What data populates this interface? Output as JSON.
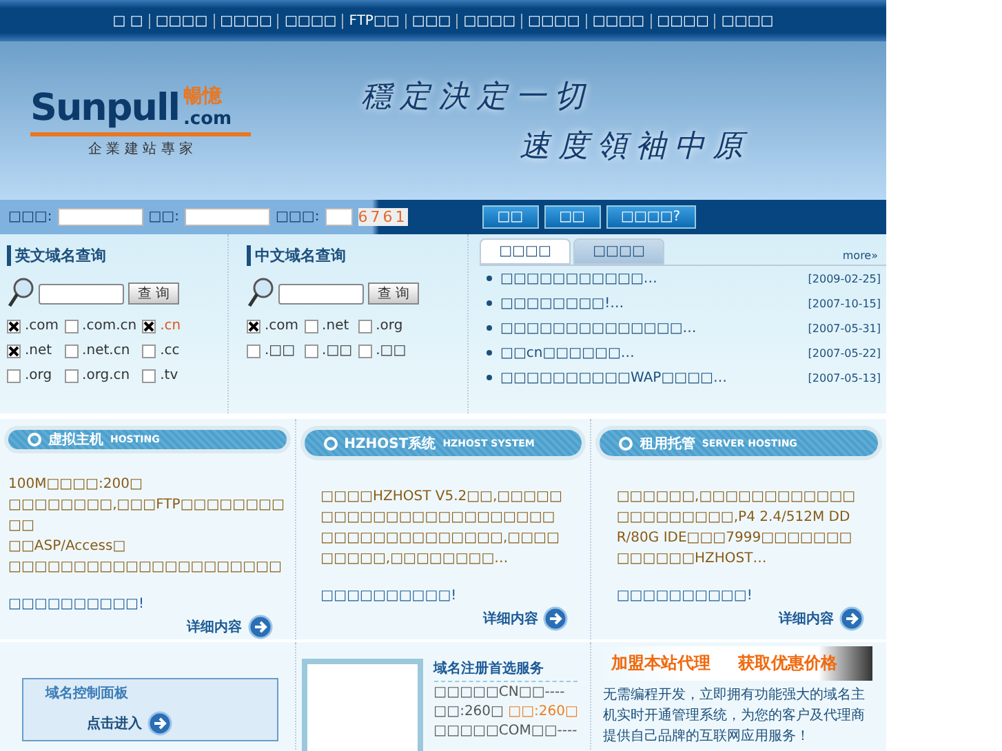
{
  "nav": [
    "□ □",
    "□□□□",
    "□□□□",
    "□□□□",
    "FTP□□",
    "□□□",
    "□□□□",
    "□□□□",
    "□□□□",
    "□□□□",
    "□□□□"
  ],
  "header": {
    "logo": "Sunpull",
    "logo_cn": "暢憶",
    "logo_com": ".com",
    "tagline": "企 業 建 站 專 家",
    "slogan": [
      "穩定決定一切",
      "速度領袖中原"
    ]
  },
  "login": {
    "fields": [
      {
        "label": "□□□:",
        "wide": true
      },
      {
        "label": "□□:",
        "wide": true
      },
      {
        "label": "□□□:",
        "wide": false
      }
    ],
    "captcha": "6761",
    "buttons": [
      "□□",
      "□□",
      "□□□□?"
    ]
  },
  "domain_search": [
    {
      "title": "英文域名查询",
      "button": "查 询",
      "options": [
        {
          "label": ".com",
          "checked": true,
          "highlight": false
        },
        {
          "label": ".com.cn",
          "checked": false,
          "highlight": false
        },
        {
          "label": ".cn",
          "checked": true,
          "highlight": true
        },
        {
          "label": ".net",
          "checked": true,
          "highlight": false
        },
        {
          "label": ".net.cn",
          "checked": false,
          "highlight": false
        },
        {
          "label": ".cc",
          "checked": false,
          "highlight": false
        },
        {
          "label": ".org",
          "checked": false,
          "highlight": false
        },
        {
          "label": ".org.cn",
          "checked": false,
          "highlight": false
        },
        {
          "label": ".tv",
          "checked": false,
          "highlight": false
        }
      ]
    },
    {
      "title": "中文域名查询",
      "button": "查 询",
      "options": [
        {
          "label": ".com",
          "checked": true,
          "highlight": false
        },
        {
          "label": ".net",
          "checked": false,
          "highlight": false
        },
        {
          "label": ".org",
          "checked": false,
          "highlight": false
        },
        {
          "label": ".□□",
          "checked": false,
          "highlight": false
        },
        {
          "label": ".□□",
          "checked": false,
          "highlight": false
        },
        {
          "label": ".□□",
          "checked": false,
          "highlight": false
        }
      ]
    }
  ],
  "news": {
    "tabs": [
      {
        "label": "□□□□",
        "selected": true
      },
      {
        "label": "□□□□",
        "selected": false
      }
    ],
    "more": "more»",
    "items": [
      {
        "title": "□□□□□□□□□□□…",
        "date": "[2009-02-25]"
      },
      {
        "title": "□□□□□□□□!…",
        "date": "[2007-10-15]"
      },
      {
        "title": "□□□□□□□□□□□□□□…",
        "date": "[2007-05-31]"
      },
      {
        "title": "□□cn□□□□□□…",
        "date": "[2007-05-22]"
      },
      {
        "title": "□□□□□□□□□□WAP□□□□…",
        "date": "[2007-05-13]"
      }
    ]
  },
  "services": [
    {
      "title": "虚拟主机",
      "subtitle": "HOSTING",
      "lines": [
        "100M□□□□:200□",
        "□□□□□□□□,□□□FTP□□□□□□□□□□",
        "□□ASP/Access□",
        "□□□□□□□□□□□□□□□□□□□□□"
      ],
      "link": "□□□□□□□□□□!",
      "more": "详细内容"
    },
    {
      "title": "HZHOST系统",
      "subtitle": "HZHOST SYSTEM",
      "lines": [
        "□□□□HZHOST V5.2□□,□□□□□□□□□□□□□□□□□□□□□□□□□□□□□□□□□□□□□,□□□□□□□□□,□□□□□□□□…"
      ],
      "link": "□□□□□□□□□□!",
      "more": "详细内容"
    },
    {
      "title": "租用托管",
      "subtitle": "SERVER HOSTING",
      "lines": [
        "□□□□□□,□□□□□□□□□□□□□□□□□□□□□,P4 2.4/512M DDR/80G IDE□□□7999□□□□□□□□□□□□□HZHOST…"
      ],
      "link": "□□□□□□□□□□!",
      "more": "详细内容"
    }
  ],
  "control_panel": {
    "title": "域名控制面板",
    "enter": "点击进入"
  },
  "domain_service": {
    "title": "域名注册首选服务",
    "lines": [
      "□□□□□CN□□----",
      "□□:260□ ",
      "□□:260□",
      "□□□□□COM□□----"
    ]
  },
  "agent": {
    "banner": [
      "加盟本站代理",
      "获取优惠价格"
    ],
    "text": "无需编程开发，立即拥有功能强大的域名主机实时开通管理系统，为您的客户及代理商提供自己品牌的互联网应用服务！"
  }
}
